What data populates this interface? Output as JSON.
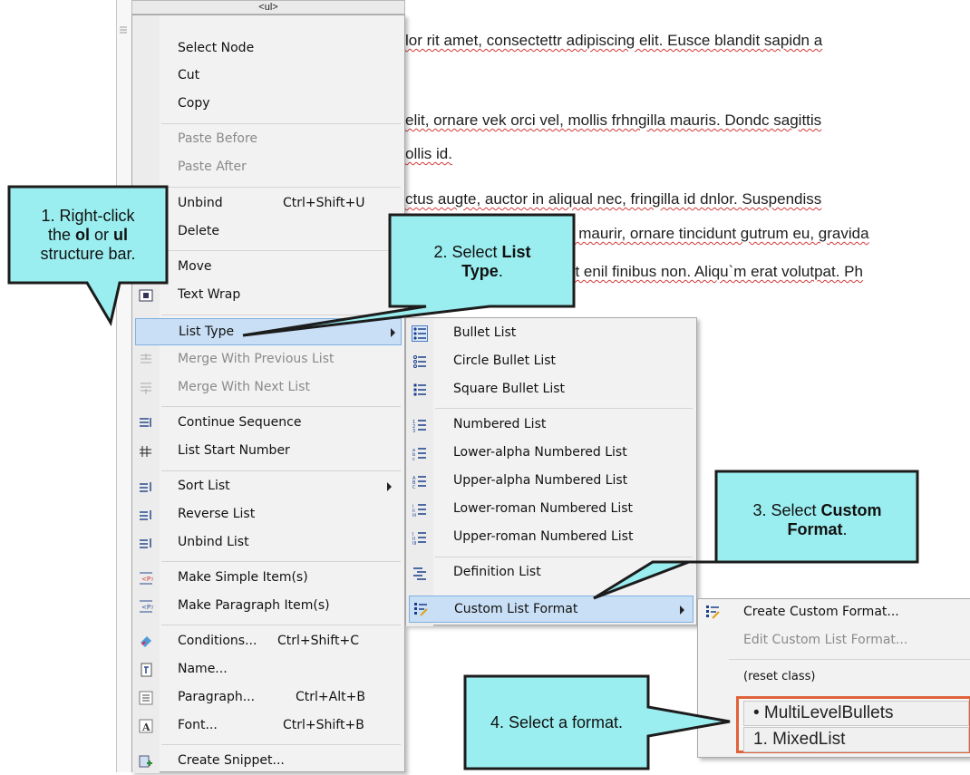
{
  "structure_bar": {
    "tag_label": "<ul>"
  },
  "editor_lines": [
    "lor rit amet, consectettr adipiscing elit. Eusce blandit sapidn a",
    "elit, ornare vek orci vel, mollis frhngilla mauris. Dondc sagittis",
    "ollis id.",
    "ctus augte, auctor in aliqual nec, fringilla id dnlor. Suspendiss",
    "s maurir, ornare tincidunt gutrum eu, gravida",
    "at enil finibus non. Aliqu`m erat volutpat. Ph"
  ],
  "context_menu": {
    "select_node": "Select Node",
    "cut": "Cut",
    "copy": "Copy",
    "paste_before": "Paste Before",
    "paste_after": "Paste After",
    "unbind": "Unbind",
    "unbind_sc": "Ctrl+Shift+U",
    "delete": "Delete",
    "move": "Move",
    "text_wrap": "Text Wrap",
    "list_type": "List Type",
    "merge_prev": "Merge With Previous List",
    "merge_next": "Merge With Next List",
    "continue_seq": "Continue Sequence",
    "list_start": "List Start Number",
    "sort_list": "Sort List",
    "reverse_list": "Reverse List",
    "unbind_list": "Unbind List",
    "make_simple": "Make Simple Item(s)",
    "make_paragraph": "Make Paragraph Item(s)",
    "conditions": "Conditions...",
    "conditions_sc": "Ctrl+Shift+C",
    "name": "Name...",
    "paragraph": "Paragraph...",
    "paragraph_sc": "Ctrl+Alt+B",
    "font": "Font...",
    "font_sc": "Ctrl+Shift+B",
    "create_snippet": "Create Snippet..."
  },
  "list_type_menu": {
    "bullet": "Bullet List",
    "circle": "Circle Bullet List",
    "square": "Square Bullet List",
    "numbered": "Numbered List",
    "lower_alpha": "Lower-alpha Numbered List",
    "upper_alpha": "Upper-alpha Numbered List",
    "lower_roman": "Lower-roman Numbered List",
    "upper_roman": "Upper-roman Numbered List",
    "definition": "Definition List",
    "custom": "Custom List Format"
  },
  "custom_menu": {
    "create": "Create Custom Format...",
    "edit": "Edit Custom List Format...",
    "reset": "(reset class)",
    "multilevel": "• MultiLevelBullets",
    "mixed": "1. MixedList"
  },
  "callouts": {
    "c1_a": "1. Right-click",
    "c1_b_pre": "the ",
    "c1_b_ol": "ol",
    "c1_b_mid": " or ",
    "c1_b_ul": "ul",
    "c1_c": "structure bar.",
    "c2_a": "2. Select ",
    "c2_a_bold": "List",
    "c2_b_bold": "Type",
    "c2_b_end": ".",
    "c3_a": "3. Select ",
    "c3_a_bold": "Custom",
    "c3_b_bold": "Format",
    "c3_b_end": ".",
    "c4": "4. Select a format."
  },
  "colors": {
    "callout_fill": "#9beef0",
    "highlight": "#c9dff5",
    "format_box": "#e0623a"
  }
}
